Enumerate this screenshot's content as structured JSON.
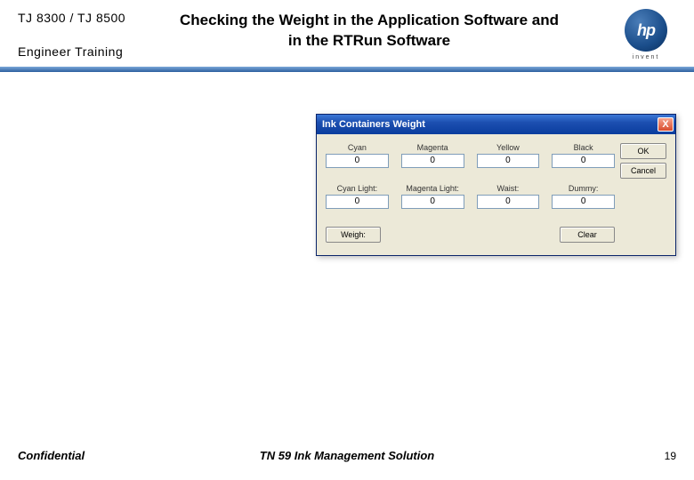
{
  "header": {
    "model": "TJ 8300 / TJ 8500",
    "subtitle": "Engineer  Training",
    "title": "Checking the Weight in the Application Software and in the RTRun Software",
    "logo_text": "hp",
    "logo_tagline": "invent"
  },
  "dialog": {
    "title": "Ink Containers Weight",
    "close": "X",
    "row1": [
      {
        "label": "Cyan",
        "value": "0"
      },
      {
        "label": "Magenta",
        "value": "0"
      },
      {
        "label": "Yellow",
        "value": "0"
      },
      {
        "label": "Black",
        "value": "0"
      }
    ],
    "row2": [
      {
        "label": "Cyan Light:",
        "value": "0"
      },
      {
        "label": "Magenta Light:",
        "value": "0"
      },
      {
        "label": "Waist:",
        "value": "0"
      },
      {
        "label": "Dummy:",
        "value": "0"
      }
    ],
    "ok": "OK",
    "cancel": "Cancel",
    "weigh": "Weigh:",
    "clear": "Clear"
  },
  "footer": {
    "confidential": "Confidential",
    "doc": "TN 59 Ink Management Solution",
    "page": "19"
  }
}
